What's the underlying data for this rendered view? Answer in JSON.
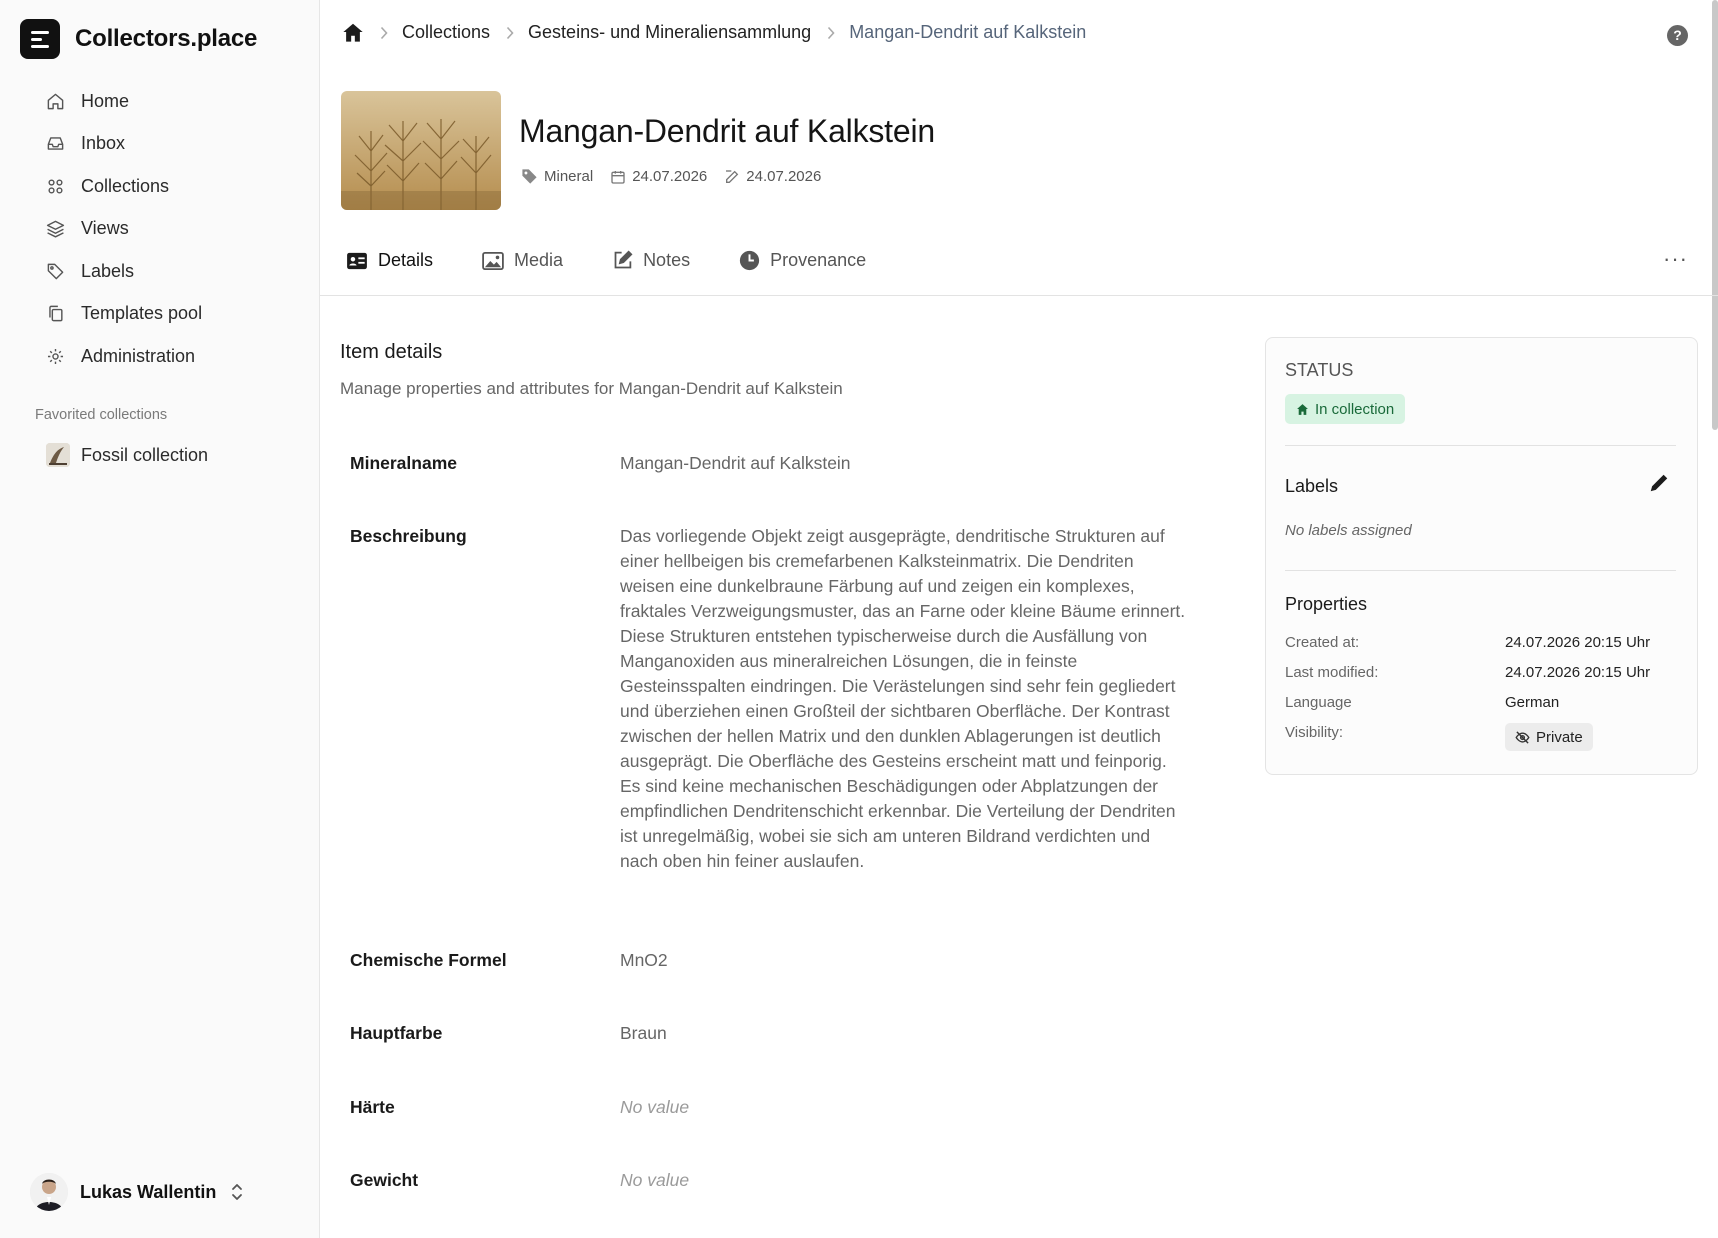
{
  "app": {
    "name": "Collectors.place"
  },
  "sidebar": {
    "items": [
      {
        "label": "Home",
        "icon": "home-icon"
      },
      {
        "label": "Inbox",
        "icon": "inbox-icon"
      },
      {
        "label": "Collections",
        "icon": "grid-icon"
      },
      {
        "label": "Views",
        "icon": "layers-icon"
      },
      {
        "label": "Labels",
        "icon": "tag-icon"
      },
      {
        "label": "Templates pool",
        "icon": "copy-icon"
      },
      {
        "label": "Administration",
        "icon": "gear-icon"
      }
    ],
    "favorites_heading": "Favorited collections",
    "favorites": [
      {
        "label": "Fossil collection"
      }
    ],
    "user": {
      "name": "Lukas Wallentin"
    }
  },
  "breadcrumb": {
    "items": [
      "Collections",
      "Gesteins- und Mineraliensammlung"
    ],
    "current": "Mangan-Dendrit auf Kalkstein"
  },
  "item": {
    "title": "Mangan-Dendrit auf Kalkstein",
    "type": "Mineral",
    "created": "24.07.2026",
    "modified": "24.07.2026"
  },
  "tabs": [
    {
      "label": "Details",
      "icon": "id-card-icon",
      "active": true
    },
    {
      "label": "Media",
      "icon": "image-icon"
    },
    {
      "label": "Notes",
      "icon": "edit-icon"
    },
    {
      "label": "Provenance",
      "icon": "clock-icon"
    }
  ],
  "details": {
    "title": "Item details",
    "subtitle": "Manage properties and attributes for Mangan-Dendrit auf Kalkstein",
    "empty_value": "No value",
    "fields": [
      {
        "label": "Mineralname",
        "value": "Mangan-Dendrit auf Kalkstein"
      },
      {
        "label": "Beschreibung",
        "value": "Das vorliegende Objekt zeigt ausgeprägte, dendritische Strukturen auf einer hellbeigen bis cremefarbenen Kalksteinmatrix. Die Dendriten weisen eine dunkelbraune Färbung auf und zeigen ein komplexes, fraktales Verzweigungsmuster, das an Farne oder kleine Bäume erinnert. Diese Strukturen entstehen typischerweise durch die Ausfällung von Manganoxiden aus mineralreichen Lösungen, die in feinste Gesteinsspalten eindringen. Die Verästelungen sind sehr fein gegliedert und überziehen einen Großteil der sichtbaren Oberfläche. Der Kontrast zwischen der hellen Matrix und den dunklen Ablagerungen ist deutlich ausgeprägt. Die Oberfläche des Gesteins erscheint matt und feinporig. Es sind keine mechanischen Beschädigungen oder Abplatzungen der empfindlichen Dendritenschicht erkennbar. Die Verteilung der Dendriten ist unregelmäßig, wobei sie sich am unteren Bildrand verdichten und nach oben hin feiner auslaufen."
      },
      {
        "label": "Chemische Formel",
        "value": "MnO2"
      },
      {
        "label": "Hauptfarbe",
        "value": "Braun"
      },
      {
        "label": "Härte",
        "value": "No value"
      },
      {
        "label": "Gewicht",
        "value": "No value"
      }
    ]
  },
  "status_card": {
    "heading": "STATUS",
    "status": "In collection",
    "labels_heading": "Labels",
    "no_labels": "No labels assigned",
    "properties_heading": "Properties",
    "properties": [
      {
        "key": "Created at:",
        "value": "24.07.2026 20:15 Uhr"
      },
      {
        "key": "Last modified:",
        "value": "24.07.2026 20:15 Uhr"
      },
      {
        "key": "Language",
        "value": "German"
      },
      {
        "key": "Visibility:",
        "value": "Private"
      }
    ]
  },
  "colors": {
    "accent_green_bg": "#d7f3e2",
    "accent_green_text": "#1a6a3a",
    "breadcrumb_current": "#56657a"
  }
}
